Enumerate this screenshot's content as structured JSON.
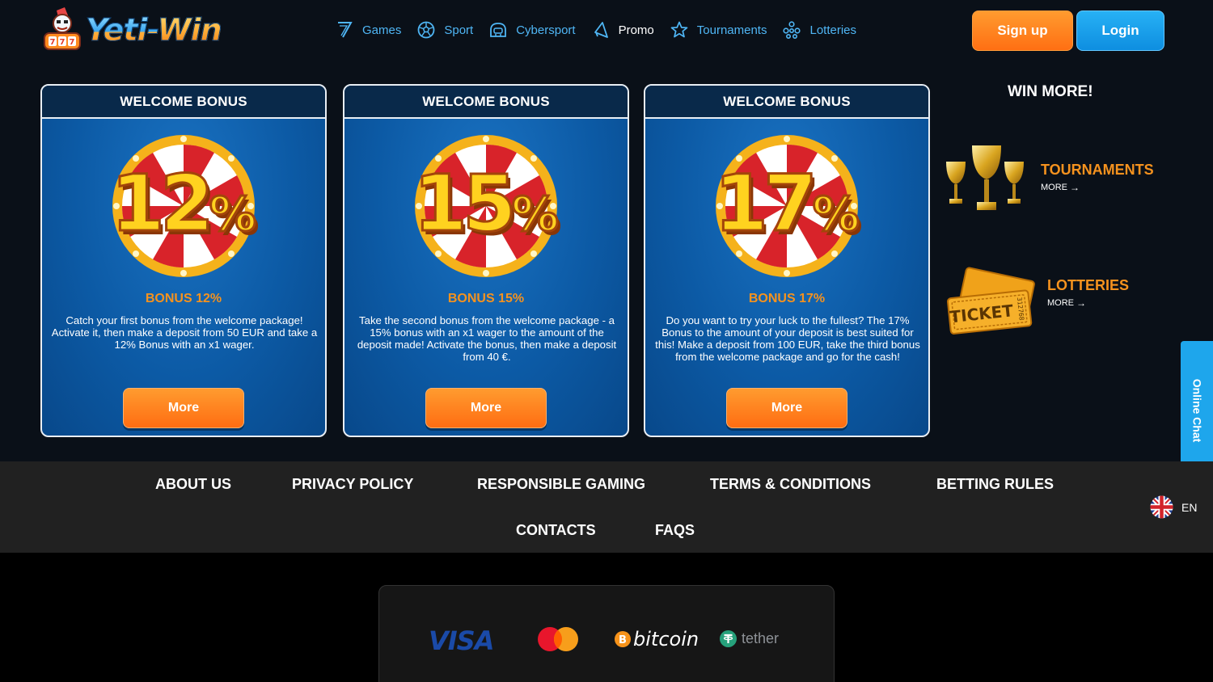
{
  "header": {
    "logo_text_a": "Yeti-",
    "logo_text_b": "Win",
    "nav": [
      {
        "label": "Games",
        "icon": "seven-icon"
      },
      {
        "label": "Sport",
        "icon": "soccer-ball-icon"
      },
      {
        "label": "Cybersport",
        "icon": "gamepad-helmet-icon"
      },
      {
        "label": "Promo",
        "icon": "megaphone-icon"
      },
      {
        "label": "Tournaments",
        "icon": "star-icon"
      },
      {
        "label": "Lotteries",
        "icon": "molecule-icon"
      }
    ],
    "signup_label": "Sign up",
    "login_label": "Login"
  },
  "bonus_cards": [
    {
      "header": "WELCOME BONUS",
      "percent": "12",
      "percent_sign": "%",
      "title": "BONUS 12%",
      "description": "Catch your first bonus from the welcome package! Activate it, then make a deposit from 50 EUR and take a 12% Bonus with an x1 wager.",
      "button": "More"
    },
    {
      "header": "WELCOME BONUS",
      "percent": "15",
      "percent_sign": "%",
      "title": "BONUS 15%",
      "description": "Take the second bonus from the welcome package - a 15% bonus with an x1 wager to the amount of the deposit made! Activate the bonus, then make a deposit from 40 €.",
      "button": "More"
    },
    {
      "header": "WELCOME BONUS",
      "percent": "17",
      "percent_sign": "%",
      "title": "BONUS 17%",
      "description": "Do you want to try your luck to the fullest? The 17% Bonus to the amount of your deposit is best suited for this! Make a deposit from 100 EUR, take the third bonus from the welcome package and go for the cash!",
      "button": "More"
    }
  ],
  "win_more": {
    "title": "WIN MORE!",
    "tournaments": {
      "label": "TOURNAMENTS",
      "more": "MORE",
      "arrow": "→"
    },
    "lotteries": {
      "label": "LOTTERIES",
      "more": "MORE",
      "arrow": "→",
      "ticket_text": "TICKET",
      "ticket_number": "312768"
    }
  },
  "online_chat": "Online Chat",
  "footer_nav": {
    "row1": [
      "ABOUT US",
      "PRIVACY POLICY",
      "RESPONSIBLE GAMING",
      "TERMS & CONDITIONS",
      "BETTING RULES"
    ],
    "row2": [
      "CONTACTS",
      "FAQS"
    ]
  },
  "language": "EN",
  "payments": {
    "visa": "VISA",
    "bitcoin": "bitcoin",
    "tether": "tether"
  },
  "colors": {
    "accent_orange": "#ff7a18",
    "accent_blue": "#1ea6ec",
    "nav_text": "#4fb6f5",
    "card_blue": "#0c5aa5",
    "bonus_title": "#f5921e"
  }
}
